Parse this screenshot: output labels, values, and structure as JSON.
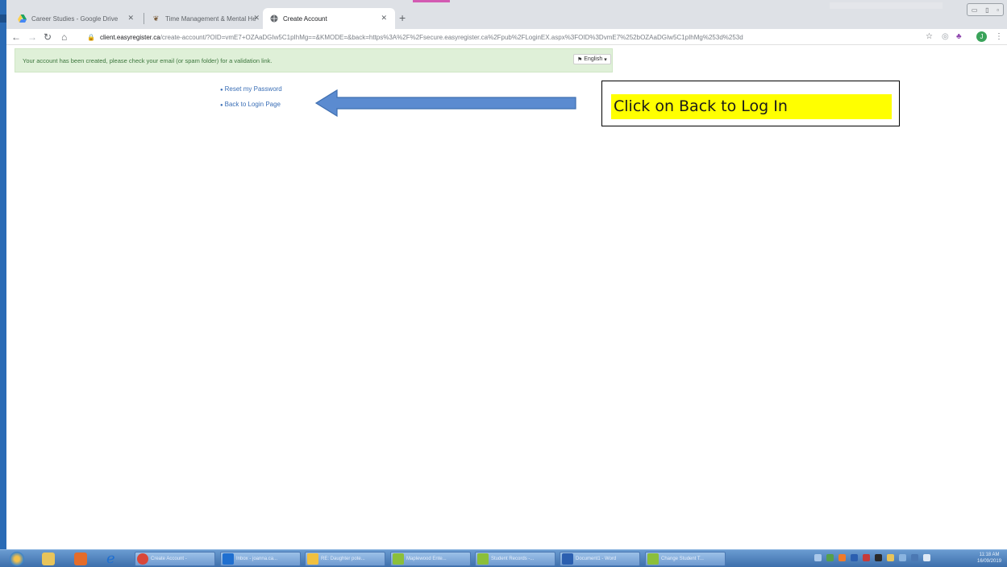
{
  "browser": {
    "tabs": [
      {
        "title": "Career Studies - Google Drive",
        "icon": "google-drive-icon",
        "active": false
      },
      {
        "title": "Time Management & Mental He",
        "icon": "wellness-icon",
        "active": false
      },
      {
        "title": "Create Account",
        "icon": "globe-icon",
        "active": true
      }
    ],
    "new_tab_label": "+",
    "url_host": "client.easyregister.ca",
    "url_path": "/create-account/?OID=vmE7+OZAaDGIw5C1pIhMg==&KMODE=&back=https%3A%2F%2Fsecure.easyregister.ca%2Fpub%2FLoginEX.aspx%3FOID%3DvmE7%252bOZAaDGIw5C1pIhMg%253d%253d"
  },
  "page": {
    "banner_message": "Your account has been created, please check your email (or spam folder) for a validation link.",
    "language_button": "English",
    "links": [
      {
        "label": "Reset my Password"
      },
      {
        "label": "Back to Login Page"
      }
    ]
  },
  "annotation": {
    "callout_text": "Click on Back to Log In",
    "arrow_color": "#5b8bd0",
    "highlight_color": "#ffff00"
  },
  "taskbar": {
    "items": [
      {
        "label": "Create Account -",
        "color": "#d9473a"
      },
      {
        "label": "Inbox - joanna.ca...",
        "color": "#1f6fd0"
      },
      {
        "label": "RE: Daughter pote...",
        "color": "#f0c040"
      },
      {
        "label": "Maplewood Ente...",
        "color": "#8bbf3a"
      },
      {
        "label": "Student Records -...",
        "color": "#8bbf3a"
      },
      {
        "label": "Document1 - Word",
        "color": "#2b5fb0"
      },
      {
        "label": "Change Student T...",
        "color": "#8bbf3a"
      }
    ],
    "time": "11:18 AM",
    "date": "16/09/2019"
  }
}
